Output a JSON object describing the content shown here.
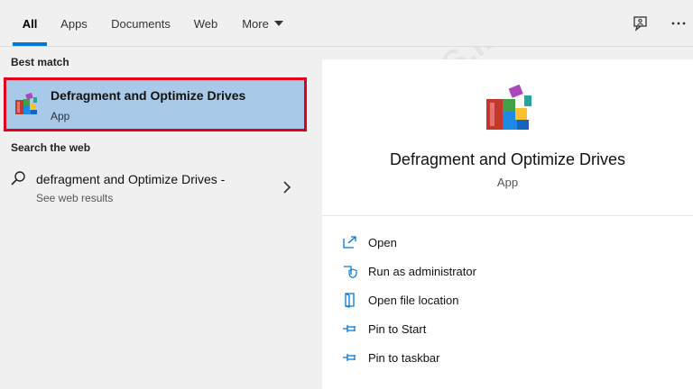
{
  "tabs": [
    {
      "label": "All",
      "active": true
    },
    {
      "label": "Apps"
    },
    {
      "label": "Documents"
    },
    {
      "label": "Web"
    },
    {
      "label": "More"
    }
  ],
  "sections": {
    "best_match": "Best match",
    "search_web": "Search the web"
  },
  "best_match_item": {
    "title": "Defragment and Optimize Drives",
    "subtitle": "App",
    "icon": "defrag-app-icon"
  },
  "web_result": {
    "query": "defragment and Optimize Drives -",
    "subtitle": "See web results"
  },
  "detail": {
    "title": "Defragment and Optimize Drives",
    "subtitle": "App"
  },
  "actions": [
    {
      "label": "Open",
      "icon": "open-icon"
    },
    {
      "label": "Run as administrator",
      "icon": "shield-icon"
    },
    {
      "label": "Open file location",
      "icon": "folder-icon"
    },
    {
      "label": "Pin to Start",
      "icon": "pin-icon"
    },
    {
      "label": "Pin to taskbar",
      "icon": "pin-icon"
    }
  ],
  "watermark": "CHARIS.ID",
  "colors": {
    "accent": "#0078d7",
    "selection": "#a9c9e9",
    "highlight_border": "#e0001b"
  }
}
